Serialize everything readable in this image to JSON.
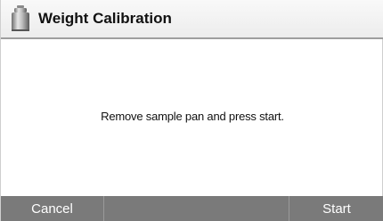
{
  "title_bar": {
    "icon": "calibration-weight-icon",
    "title": "Weight Calibration"
  },
  "content": {
    "message": "Remove  sample pan and press start."
  },
  "toolbar": {
    "cancel_label": "Cancel",
    "middle_label": "",
    "start_label": "Start"
  },
  "colors": {
    "toolbar_bg": "#7a7a7a",
    "title_bg": "#f2f2f2",
    "divider": "#9e9e9e"
  }
}
